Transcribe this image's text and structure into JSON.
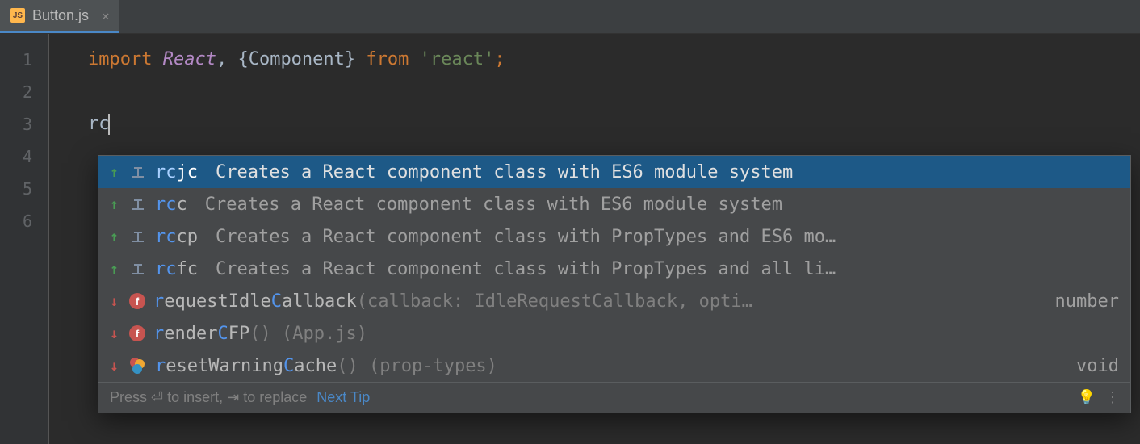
{
  "tab": {
    "icon_label": "JS",
    "filename": "Button.js",
    "close": "✕"
  },
  "gutter": [
    "1",
    "2",
    "3",
    "4",
    "5",
    "6"
  ],
  "code": {
    "line1": {
      "kw1": "import ",
      "react": "React",
      "comma": ", ",
      "lbrace": "{",
      "comp": "Component",
      "rbrace": "}",
      "kw2": " from ",
      "str": "'react'",
      "semi": ";"
    },
    "line3": {
      "typed": "rc"
    }
  },
  "popup": {
    "items": [
      {
        "arrow": "up",
        "icon": "template",
        "parts": [
          "rc",
          "jc"
        ],
        "desc": "Creates a React component class with ES6 module system",
        "right": "",
        "selected": true
      },
      {
        "arrow": "up",
        "icon": "template",
        "parts": [
          "rc",
          "c"
        ],
        "desc": "Creates a React component class with ES6 module system",
        "right": "",
        "selected": false
      },
      {
        "arrow": "up",
        "icon": "template",
        "parts": [
          "rc",
          "cp"
        ],
        "desc": "Creates a React component class with PropTypes and ES6 mo…",
        "right": "",
        "selected": false
      },
      {
        "arrow": "up",
        "icon": "template",
        "parts": [
          "rc",
          "fc"
        ],
        "desc": "Creates a React component class with PropTypes and all li…",
        "right": "",
        "selected": false
      },
      {
        "arrow": "down",
        "icon": "function",
        "icon_label": "f",
        "name_html": "requestIdleCallback",
        "hl_positions": [
          0,
          11
        ],
        "sig": "(callback: IdleRequestCallback, opti…",
        "right": "number",
        "selected": false
      },
      {
        "arrow": "down",
        "icon": "function",
        "icon_label": "f",
        "name_html": "renderCFP",
        "hl_positions": [
          0,
          6
        ],
        "sig": "() (App.js)",
        "right": "",
        "selected": false
      },
      {
        "arrow": "down",
        "icon": "multi",
        "name_html": "resetWarningCache",
        "hl_positions": [
          0,
          12
        ],
        "sig": "() (prop-types)",
        "right": "void",
        "selected": false
      }
    ],
    "footer": {
      "hint_pre": "Press ",
      "enter": "⏎",
      "hint_mid": " to insert, ",
      "tab": "⇥",
      "hint_post": " to replace",
      "link": "Next Tip"
    }
  }
}
